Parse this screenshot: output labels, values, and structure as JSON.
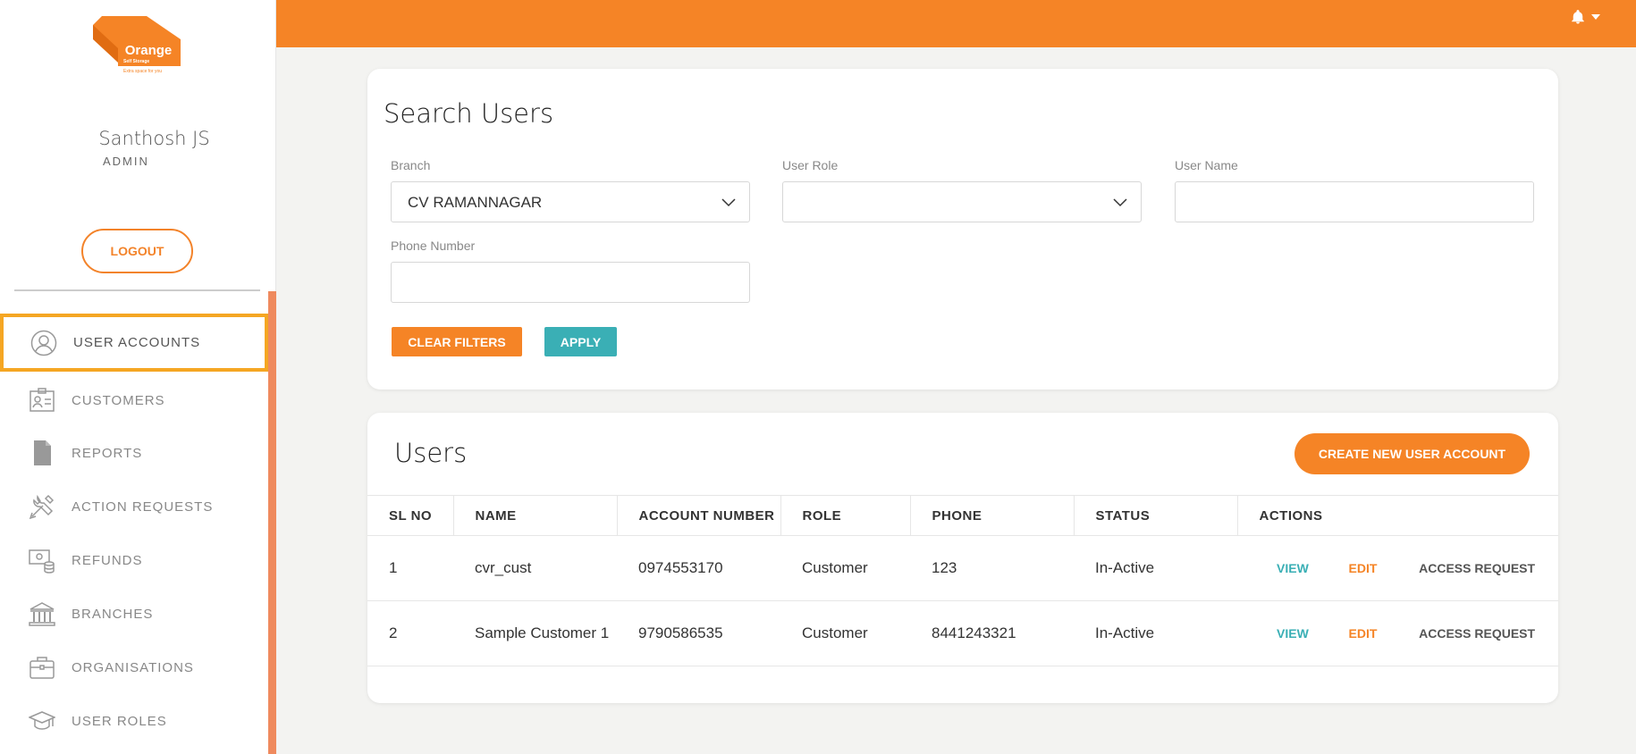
{
  "brand": {
    "name": "Orange",
    "subtitle": "Self Storage",
    "tagline": "Extra space for you",
    "color": "#f58426"
  },
  "profile": {
    "name": "Santhosh JS",
    "role": "ADMIN"
  },
  "sidebar": {
    "logout_label": "LOGOUT",
    "items": [
      {
        "label": "USER ACCOUNTS",
        "icon": "user-circle-icon",
        "active": true
      },
      {
        "label": "CUSTOMERS",
        "icon": "id-card-icon"
      },
      {
        "label": "REPORTS",
        "icon": "document-icon"
      },
      {
        "label": "ACTION REQUESTS",
        "icon": "tools-icon"
      },
      {
        "label": "REFUNDS",
        "icon": "refund-icon"
      },
      {
        "label": "BRANCHES",
        "icon": "bank-icon"
      },
      {
        "label": "ORGANISATIONS",
        "icon": "briefcase-icon"
      },
      {
        "label": "USER ROLES",
        "icon": "graduation-cap-icon"
      }
    ]
  },
  "header": {
    "icon": "bell-icon"
  },
  "search": {
    "title": "Search Users",
    "branch_label": "Branch",
    "branch_value": "CV RAMANNAGAR",
    "role_label": "User Role",
    "role_value": "",
    "username_label": "User Name",
    "username_value": "",
    "phone_label": "Phone Number",
    "phone_value": "",
    "clear_label": "CLEAR FILTERS",
    "apply_label": "APPLY"
  },
  "users": {
    "title": "Users",
    "create_label": "CREATE NEW USER ACCOUNT",
    "columns": [
      "SL NO",
      "NAME",
      "ACCOUNT NUMBER",
      "ROLE",
      "PHONE",
      "STATUS",
      "ACTIONS"
    ],
    "rows": [
      {
        "sl": "1",
        "name": "cvr_cust",
        "account": "0974553170",
        "role": "Customer",
        "phone": "123",
        "status": "In-Active"
      },
      {
        "sl": "2",
        "name": "Sample Customer 1",
        "account": "9790586535",
        "role": "Customer",
        "phone": "8441243321",
        "status": "In-Active"
      }
    ],
    "actions": {
      "view": "VIEW",
      "edit": "EDIT",
      "access": "ACCESS REQUEST"
    }
  }
}
